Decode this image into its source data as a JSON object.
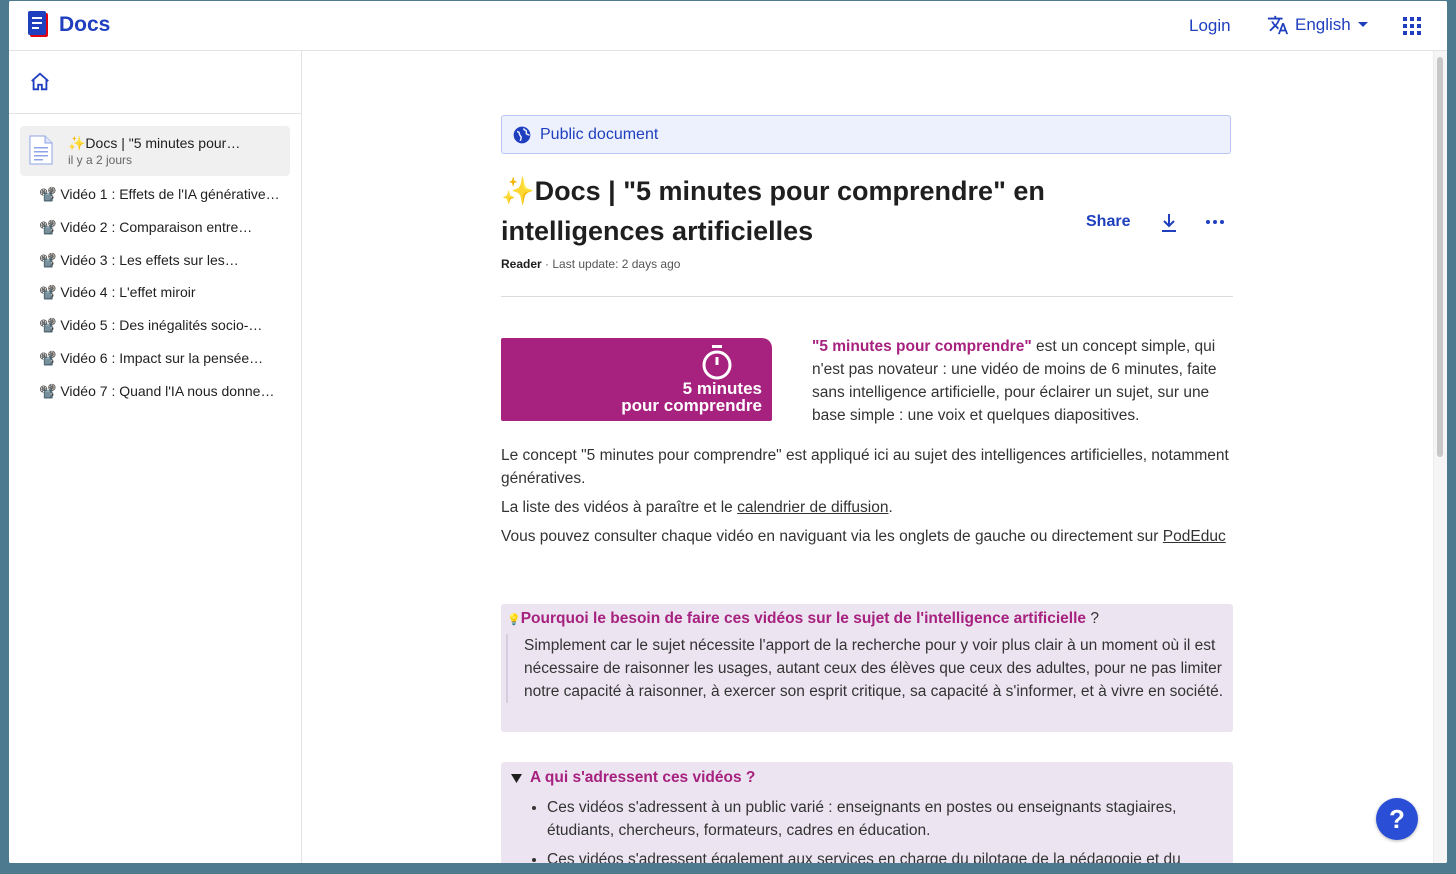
{
  "header": {
    "app_name": "Docs",
    "login_label": "Login",
    "language_label": "English"
  },
  "sidebar": {
    "current_doc": {
      "title": "✨Docs | \"5 minutes pour…",
      "updated": "il y a 2 jours"
    },
    "items": [
      {
        "label": "📽️ Vidéo 1 : Effets de l'IA générative…"
      },
      {
        "label": "📽️ Vidéo 2 : Comparaison entre…"
      },
      {
        "label": "📽️ Vidéo 3 : Les effets sur les…"
      },
      {
        "label": "📽️ Vidéo 4 : L'effet miroir"
      },
      {
        "label": "📽️ Vidéo 5 : Des inégalités socio-…"
      },
      {
        "label": "📽️ Vidéo 6 : Impact sur la pensée…"
      },
      {
        "label": "📽️ Vidéo 7 : Quand l'IA nous donne…"
      }
    ]
  },
  "doc": {
    "visibility_label": "Public document",
    "title": "✨Docs | \"5 minutes pour comprendre\" en intelligences artificielles",
    "share_label": "Share",
    "role": "Reader",
    "meta_sep": " · ",
    "last_update": "Last update: 2 days ago",
    "badge_line1": "5 minutes",
    "badge_line2": "pour comprendre",
    "intro_highlight": "\"5 minutes pour comprendre\"",
    "intro_rest": " est un concept simple, qui n'est pas novateur : une vidéo de moins de 6 minutes, faite sans intelligence artificielle, pour éclairer un sujet, sur une base simple : une voix et quelques diapositives.",
    "para1": "Le concept \"5 minutes pour comprendre\" est appliqué ici au sujet des intelligences artificielles, notamment génératives.",
    "para2_before": "La liste des vidéos à paraître et le ",
    "para2_link": "calendrier de diffusion",
    "para2_after": ".",
    "para3_before": "Vous pouvez consulter chaque vidéo en naviguant via les onglets de gauche ou directement sur ",
    "para3_link": "PodEduc",
    "callout1_emoji": "💡",
    "callout1_question": "Pourquoi le besoin de faire ces vidéos sur le sujet de l'intelligence artificielle",
    "callout1_qmark": " ?",
    "callout1_body": "Simplement car le sujet nécessite l'apport de la recherche pour y voir plus clair à un moment où il est nécessaire de raisonner les usages, autant ceux des élèves que ceux des adultes, pour ne pas limiter notre capacité à raisonner, à exercer son esprit critique, sa capacité à s'informer, et à vivre en société.",
    "callout2_heading": "A qui s'adressent ces vidéos ?",
    "callout2_items": [
      "Ces vidéos s'adressent à un public varié : enseignants en postes ou enseignants stagiaires, étudiants, chercheurs, formateurs, cadres en éducation.",
      "Ces vidéos s'adressent également aux services en charge du pilotage de la pédagogie et du"
    ]
  },
  "help_label": "?",
  "colors": {
    "brand": "#1f3fbf",
    "accent": "#a7217f",
    "callout_bg": "#ece5f1"
  }
}
